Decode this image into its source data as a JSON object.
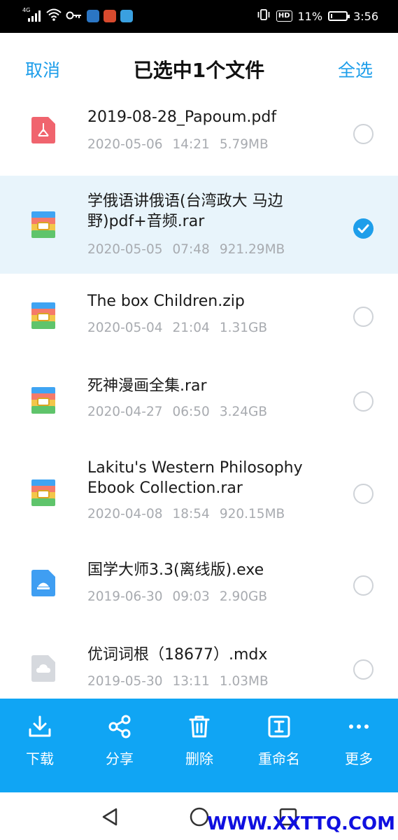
{
  "status_bar": {
    "network": "4G",
    "battery_percent": "11%",
    "battery_level": 0.11,
    "hd_badge": "HD",
    "time": "3:56",
    "icons": [
      "signal-icon",
      "wifi-icon",
      "key-icon",
      "app-icon",
      "app-icon",
      "shield-app-icon",
      "vibrate-icon",
      "battery-icon"
    ]
  },
  "header": {
    "cancel_label": "取消",
    "title": "已选中1个文件",
    "select_all_label": "全选"
  },
  "files": [
    {
      "name": "2019-08-28_Papoum.pdf",
      "date": "2020-05-06",
      "time": "14:21",
      "size": "5.79MB",
      "type": "pdf",
      "selected": false
    },
    {
      "name": "学俄语讲俄语(台湾政大 马边野)pdf+音频.rar",
      "date": "2020-05-05",
      "time": "07:48",
      "size": "921.29MB",
      "type": "archive",
      "selected": true
    },
    {
      "name": "The box Children.zip",
      "date": "2020-05-04",
      "time": "21:04",
      "size": "1.31GB",
      "type": "archive",
      "selected": false
    },
    {
      "name": "死神漫画全集.rar",
      "date": "2020-04-27",
      "time": "06:50",
      "size": "3.24GB",
      "type": "archive",
      "selected": false
    },
    {
      "name": "Lakitu's Western Philosophy Ebook Collection.rar",
      "date": "2020-04-08",
      "time": "18:54",
      "size": "920.15MB",
      "type": "archive",
      "selected": false
    },
    {
      "name": "国学大师3.3(离线版).exe",
      "date": "2019-06-30",
      "time": "09:03",
      "size": "2.90GB",
      "type": "exe",
      "selected": false
    },
    {
      "name": "优词词根（18677）.mdx",
      "date": "2019-05-30",
      "time": "13:11",
      "size": "1.03MB",
      "type": "unknown",
      "selected": false
    }
  ],
  "toolbar": {
    "download_label": "下载",
    "share_label": "分享",
    "delete_label": "删除",
    "rename_label": "重命名",
    "more_label": "更多"
  },
  "watermark": "WWW.XXTTQ.COM",
  "colors": {
    "accent": "#1e9eea",
    "toolbar_bg": "#10a5f4",
    "selected_row_bg": "#e8f4fb",
    "pdf_icon": "#f0646e",
    "exe_icon": "#3f9ef2",
    "unknown_icon": "#d6d9de"
  }
}
